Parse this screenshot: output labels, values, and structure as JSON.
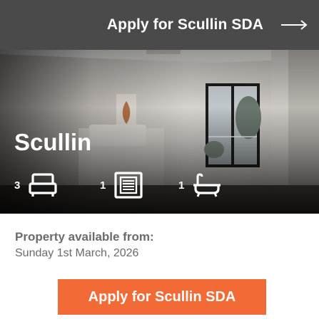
{
  "top_bar": {
    "label": "Apply for Scullin SDA",
    "arrow_icon": "arrow-right-icon"
  },
  "hero": {
    "title": "Scullin",
    "features": [
      {
        "count": "3",
        "icon": "bed-icon"
      },
      {
        "count": "1",
        "icon": "wardrobe-icon"
      },
      {
        "count": "1",
        "icon": "bathtub-icon"
      }
    ]
  },
  "details": {
    "label": "Property available from:",
    "date": "Sunday 1st March, 2026"
  },
  "apply_button": {
    "label": "Apply for Scullin SDA"
  },
  "colors": {
    "top_bar_bg": "#4a4a4a",
    "accent": "#f26a35",
    "details_text": "#6b6b6b"
  }
}
